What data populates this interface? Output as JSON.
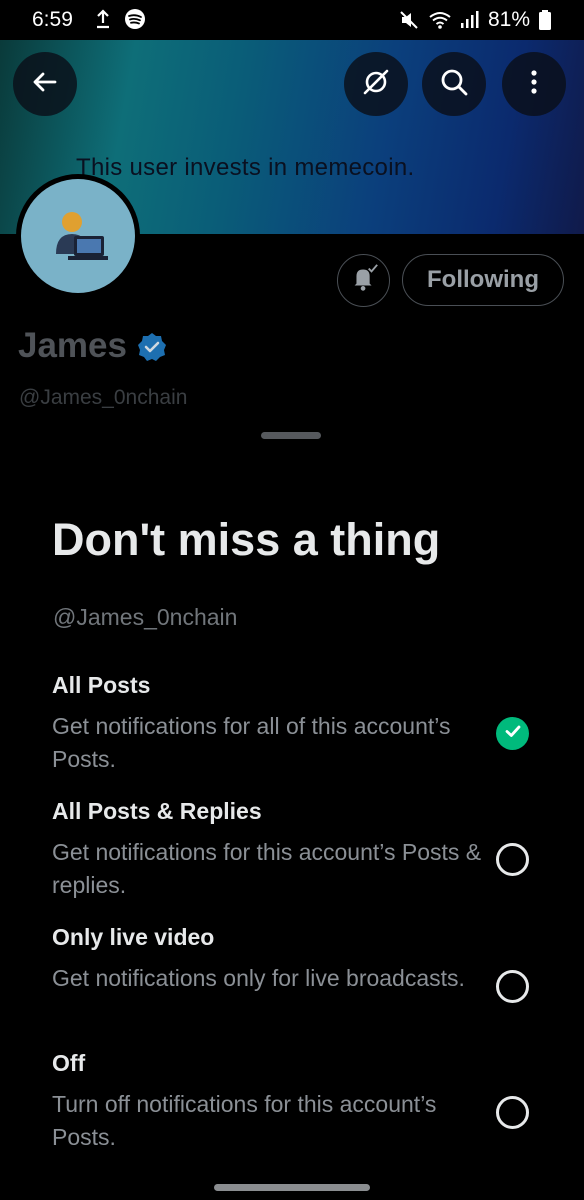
{
  "status_bar": {
    "time": "6:59",
    "battery": "81%"
  },
  "banner": {
    "text": "This user invests in memecoin."
  },
  "profile": {
    "name": "James",
    "handle": "@James_0nchain",
    "following_label": "Following"
  },
  "sheet": {
    "title": "Don't miss a thing",
    "handle": "@James_0nchain",
    "options": [
      {
        "title": "All Posts",
        "description": "Get notifications for all of this account’s Posts.",
        "selected": true
      },
      {
        "title": "All Posts & Replies",
        "description": "Get notifications for this account’s Posts & replies.",
        "selected": false
      },
      {
        "title": "Only live video",
        "description": "Get notifications only for live broadcasts.",
        "selected": false
      },
      {
        "title": "Off",
        "description": "Turn off notifications for this account’s Posts.",
        "selected": false
      }
    ]
  },
  "icons": [
    "back-arrow-icon",
    "grok-icon",
    "search-icon",
    "more-vert-icon",
    "bell-check-icon",
    "verified-badge-icon",
    "checkmark-icon"
  ],
  "colors": {
    "accent_green": "#00ba7c",
    "verified_blue": "#1d9bf0",
    "background": "#000000"
  }
}
